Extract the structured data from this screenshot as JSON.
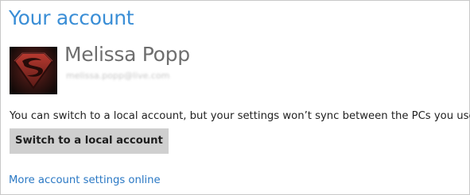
{
  "header": {
    "title": "Your account"
  },
  "account": {
    "name": "Melissa Popp",
    "email": "melissa.popp@live.com",
    "avatar_icon": "superman-shield-avatar"
  },
  "main": {
    "info_text": "You can switch to a local account, but your settings won’t sync between the PCs you use.",
    "switch_button_label": "Switch to a local account",
    "more_link_label": "More account settings online"
  },
  "colors": {
    "title": "#3a8ed6",
    "link": "#2a78c4",
    "button_bg": "#cfcfcf",
    "name_text": "#6e6e6e"
  }
}
